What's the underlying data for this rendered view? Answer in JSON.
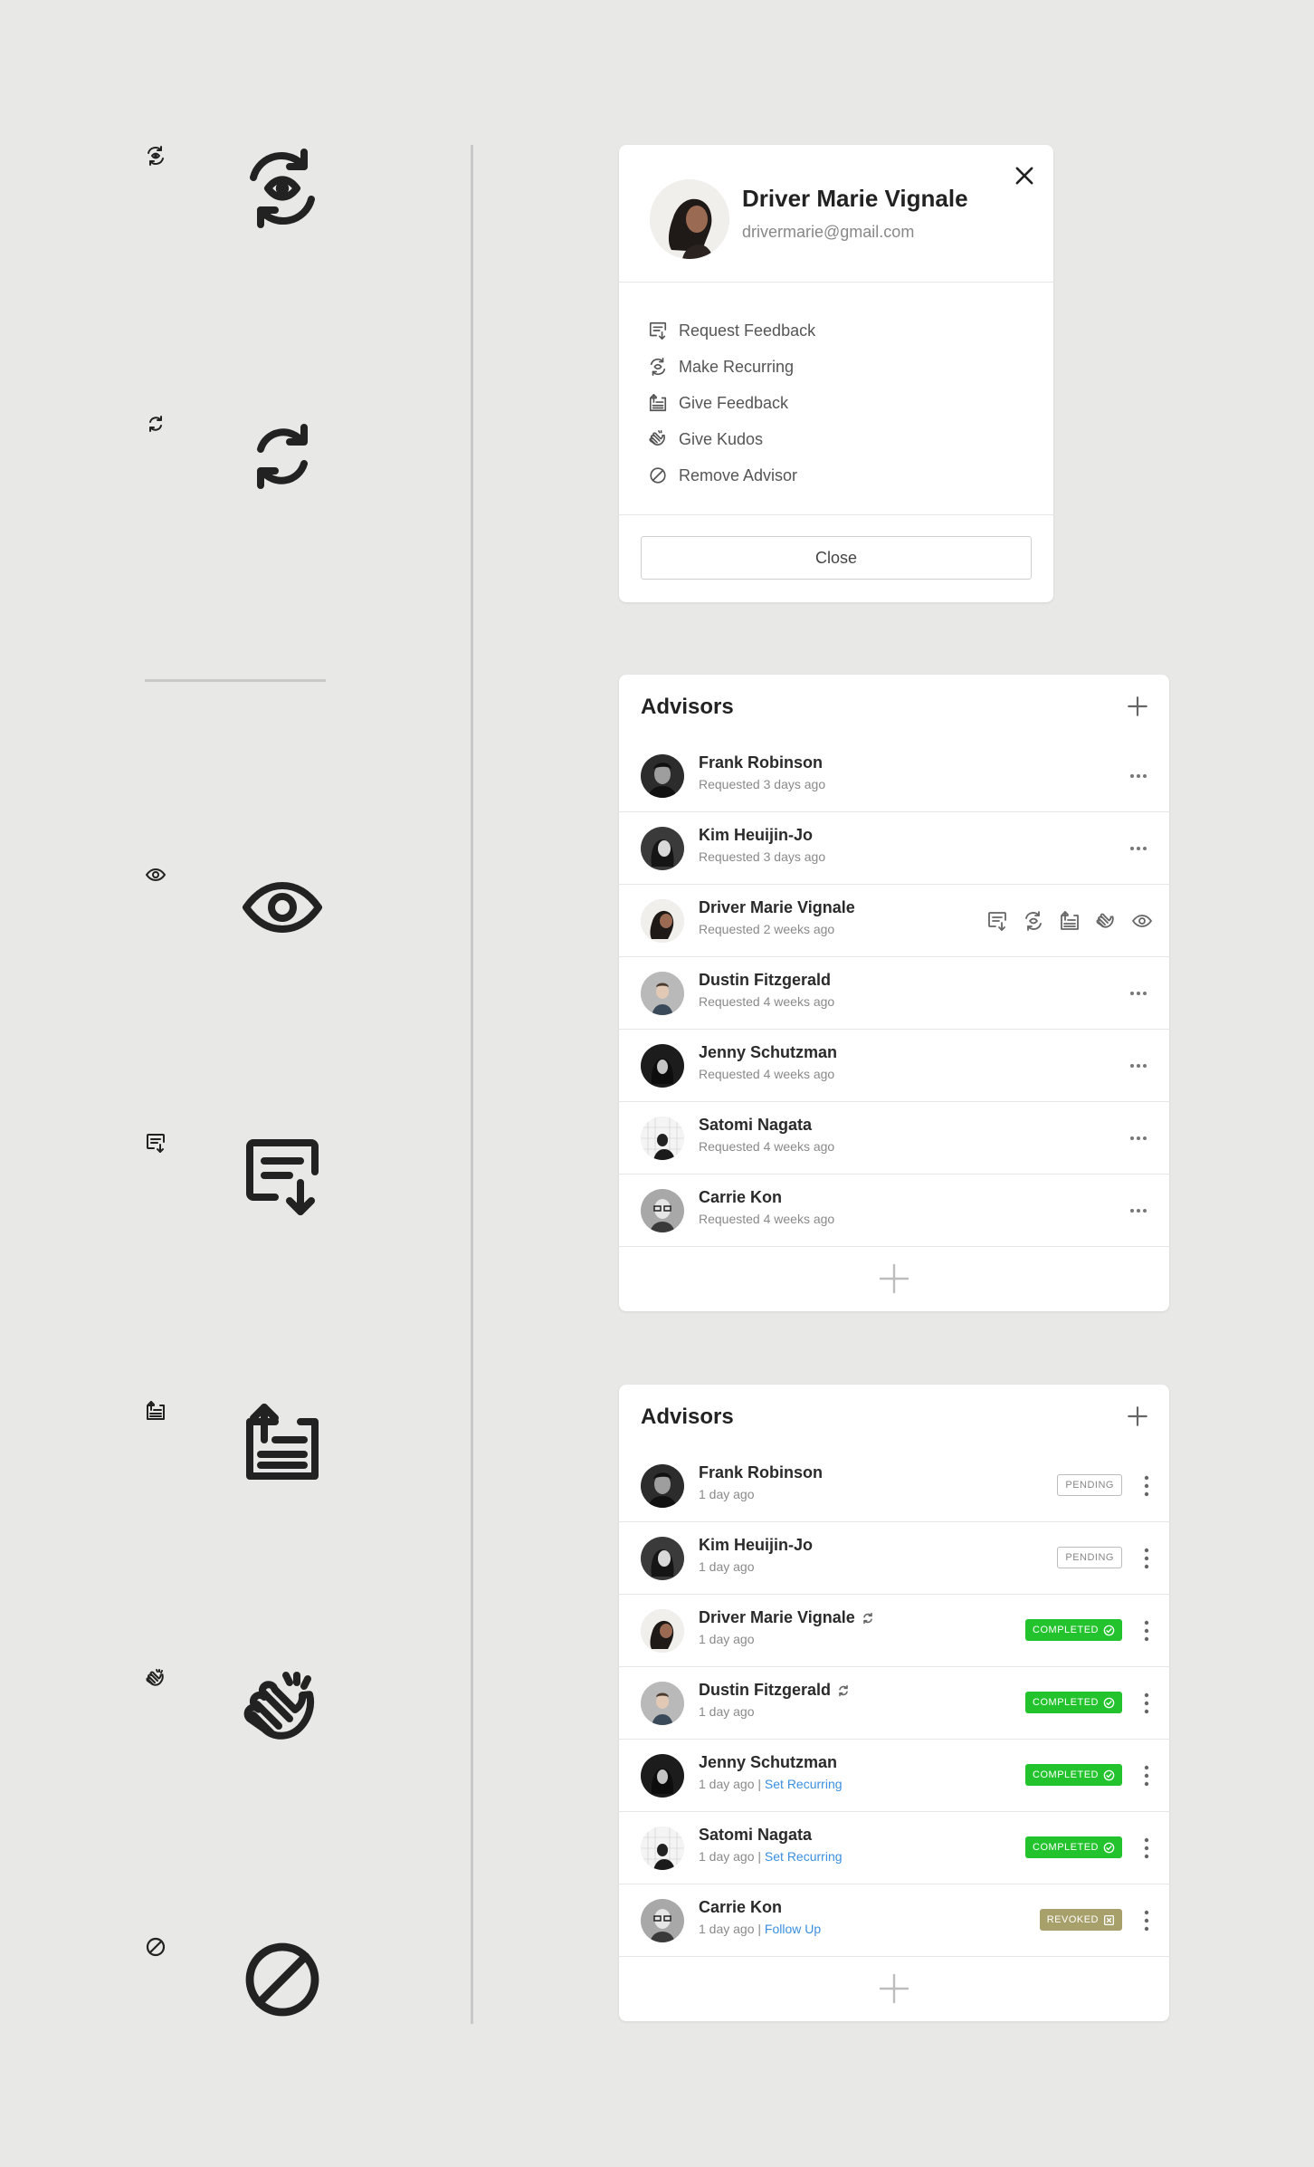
{
  "icon_gallery": [
    {
      "name": "recurring-icon"
    },
    {
      "name": "refresh-icon"
    },
    {
      "name": "eye-icon"
    },
    {
      "name": "request-feedback-icon"
    },
    {
      "name": "give-feedback-icon"
    },
    {
      "name": "kudos-clap-icon"
    },
    {
      "name": "remove-ban-icon"
    }
  ],
  "profile_card": {
    "name": "Driver Marie Vignale",
    "email": "drivermarie@gmail.com",
    "menu": [
      {
        "label": "Request Feedback",
        "icon": "request-feedback-icon"
      },
      {
        "label": "Make Recurring",
        "icon": "recurring-icon"
      },
      {
        "label": "Give Feedback",
        "icon": "give-feedback-icon"
      },
      {
        "label": "Give Kudos",
        "icon": "kudos-clap-icon"
      },
      {
        "label": "Remove Advisor",
        "icon": "remove-ban-icon"
      }
    ],
    "close_label": "Close"
  },
  "advisors_requested": {
    "title": "Advisors",
    "rows": [
      {
        "name": "Frank Robinson",
        "sub": "Requested 3 days ago"
      },
      {
        "name": "Kim Heuijin-Jo",
        "sub": "Requested 3 days ago"
      },
      {
        "name": "Driver Marie Vignale",
        "sub": "Requested 2 weeks ago"
      },
      {
        "name": "Dustin Fitzgerald",
        "sub": "Requested 4 weeks ago"
      },
      {
        "name": "Jenny Schutzman",
        "sub": "Requested 4 weeks ago"
      },
      {
        "name": "Satomi Nagata",
        "sub": "Requested 4 weeks ago"
      },
      {
        "name": "Carrie Kon",
        "sub": "Requested 4 weeks ago"
      }
    ]
  },
  "advisors_status": {
    "title": "Advisors",
    "rows": [
      {
        "name": "Frank Robinson",
        "sub": "1 day ago",
        "link": "",
        "status": "PENDING"
      },
      {
        "name": "Kim Heuijin-Jo",
        "sub": "1 day ago",
        "link": "",
        "status": "PENDING"
      },
      {
        "name": "Driver Marie Vignale",
        "sub": "1 day ago",
        "link": "",
        "status": "COMPLETED"
      },
      {
        "name": "Dustin Fitzgerald",
        "sub": "1 day ago",
        "link": "",
        "status": "COMPLETED"
      },
      {
        "name": "Jenny Schutzman",
        "sub": "1 day ago",
        "link": "Set Recurring",
        "status": "COMPLETED"
      },
      {
        "name": "Satomi Nagata",
        "sub": "1 day ago",
        "link": "Set Recurring",
        "status": "COMPLETED"
      },
      {
        "name": "Carrie Kon",
        "sub": "1 day ago",
        "link": "Follow Up",
        "status": "REVOKED"
      }
    ]
  },
  "colors": {
    "background": "#e8e8e7",
    "completed": "#22c32c",
    "revoked": "#a8a06a",
    "link": "#3b8fe0"
  }
}
